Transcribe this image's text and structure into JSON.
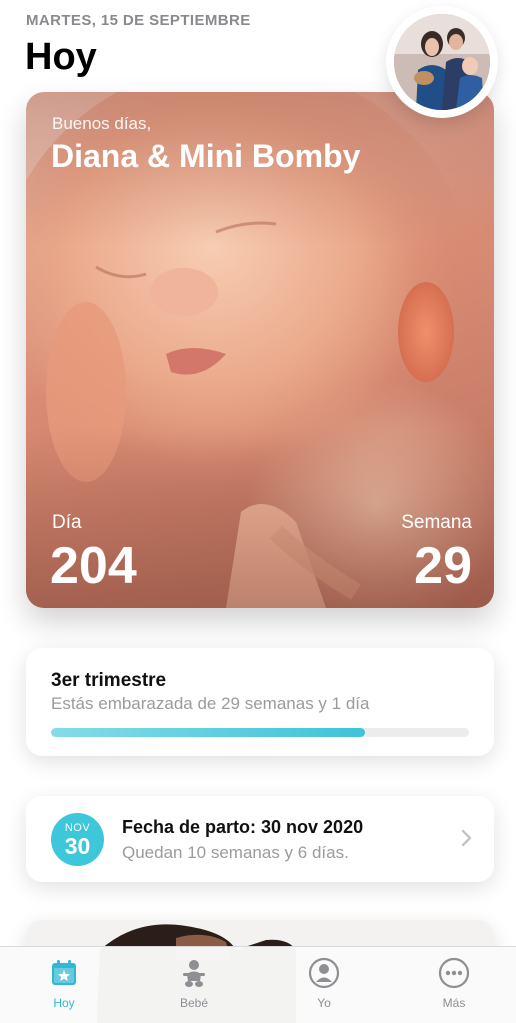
{
  "header": {
    "date": "MARTES, 15 DE SEPTIEMBRE",
    "title": "Hoy"
  },
  "hero": {
    "greeting": "Buenos días,",
    "names": "Diana & Mini Bomby",
    "day_label": "Día",
    "day_value": "204",
    "week_label": "Semana",
    "week_value": "29"
  },
  "trimester": {
    "title": "3er trimestre",
    "subtitle": "Estás embarazada de 29 semanas y 1 día",
    "progress_percent": 75
  },
  "due_date": {
    "month": "NOV",
    "day": "30",
    "title": "Fecha de parto: 30 nov 2020",
    "subtitle": "Quedan 10 semanas y 6 días."
  },
  "tabs": [
    {
      "label": "Hoy",
      "icon": "calendar-star-icon",
      "active": true
    },
    {
      "label": "Bebé",
      "icon": "baby-icon",
      "active": false
    },
    {
      "label": "Yo",
      "icon": "mother-icon",
      "active": false
    },
    {
      "label": "Más",
      "icon": "more-icon",
      "active": false
    }
  ],
  "colors": {
    "accent": "#3ec6db",
    "tab_active": "#34b8d2",
    "tab_inactive": "#8e8e93"
  }
}
